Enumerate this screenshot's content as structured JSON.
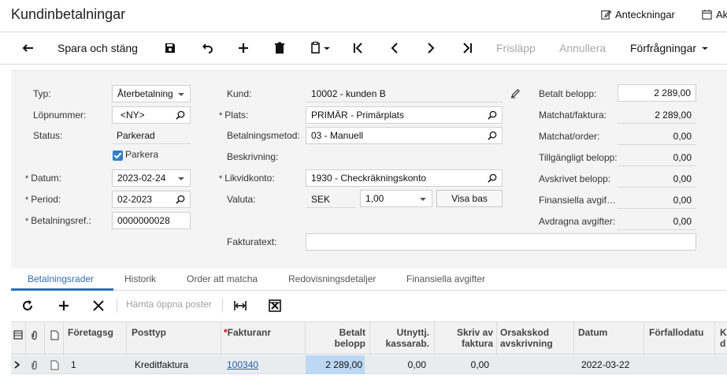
{
  "header": {
    "title": "Kundinbetalningar",
    "notes_label": "Anteckningar",
    "activities_label": "Ak"
  },
  "toolbar": {
    "save_close_label": "Spara och stäng",
    "release_label": "Frisläpp",
    "cancel_label": "Annullera",
    "inquiries_label": "Förfrågningar"
  },
  "form": {
    "type_label": "Typ:",
    "type_value": "Återbetalning",
    "refnbr_label": "Löpnummer:",
    "refnbr_value": "<NY>",
    "status_label": "Status:",
    "status_value": "Parkerad",
    "hold_label": "Parkera",
    "date_label": "Datum:",
    "date_value": "2023-02-24",
    "period_label": "Period:",
    "period_value": "02-2023",
    "payref_label": "Betalningsref.:",
    "payref_value": "0000000028",
    "customer_label": "Kund:",
    "customer_value": "10002 - kunden B",
    "location_label": "Plats:",
    "location_value": "PRIMÄR - Primärplats",
    "paymethod_label": "Betalningsmetod:",
    "paymethod_value": "03 - Manuell",
    "description_label": "Beskrivning:",
    "cashaccount_label": "Likvidkonto:",
    "cashaccount_value": "1930 - Checkräkningskonto",
    "currency_label": "Valuta:",
    "currency_value": "SEK",
    "rate_value": "1,00",
    "viewbase_label": "Visa bas",
    "invoicetext_label": "Fakturatext:",
    "paid_amount_label": "Betalt belopp:",
    "paid_amount_value": "2 289,00",
    "applied_invoice_label": "Matchat/faktura:",
    "applied_invoice_value": "2 289,00",
    "applied_order_label": "Matchat/order:",
    "applied_order_value": "0,00",
    "available_label": "Tillgängligt belopp:",
    "available_value": "0,00",
    "writeoff_label": "Avskrivet belopp:",
    "writeoff_value": "0,00",
    "finance_charges_label": "Finansiella avgif…",
    "finance_charges_value": "0,00",
    "deducted_charges_label": "Avdragna avgifter:",
    "deducted_charges_value": "0,00"
  },
  "tabs": [
    "Betalningsrader",
    "Historik",
    "Order att matcha",
    "Redovisningsdetaljer",
    "Finansiella avgifter"
  ],
  "gridbar": {
    "load_docs_label": "Hämta öppna poster"
  },
  "grid": {
    "headers": {
      "branch": "Företagsg",
      "doctype": "Posttyp",
      "refnbr": "Fakturanr",
      "paid_1": "Betalt",
      "paid_2": "belopp",
      "cashdisc_1": "Utnyttj.",
      "cashdisc_2": "kassarab.",
      "writeoff_1": "Skriv av",
      "writeoff_2": "faktura",
      "reason_1": "Orsakskod",
      "reason_2": "avskrivning",
      "date": "Datum",
      "duedate": "Förfallodatu",
      "k_1": "K",
      "k_2": "d"
    },
    "rows": [
      {
        "branch": "1",
        "doctype": "Kreditfaktura",
        "refnbr": "100340",
        "paid": "2 289,00",
        "cashdisc": "0,00",
        "writeoff": "0,00",
        "reason": "",
        "date": "2022-03-22",
        "duedate": ""
      }
    ]
  },
  "colors": {
    "accent": "#2f6fb5",
    "selected_cell": "#bcd8f3",
    "form_bg": "#f4f4f4"
  }
}
